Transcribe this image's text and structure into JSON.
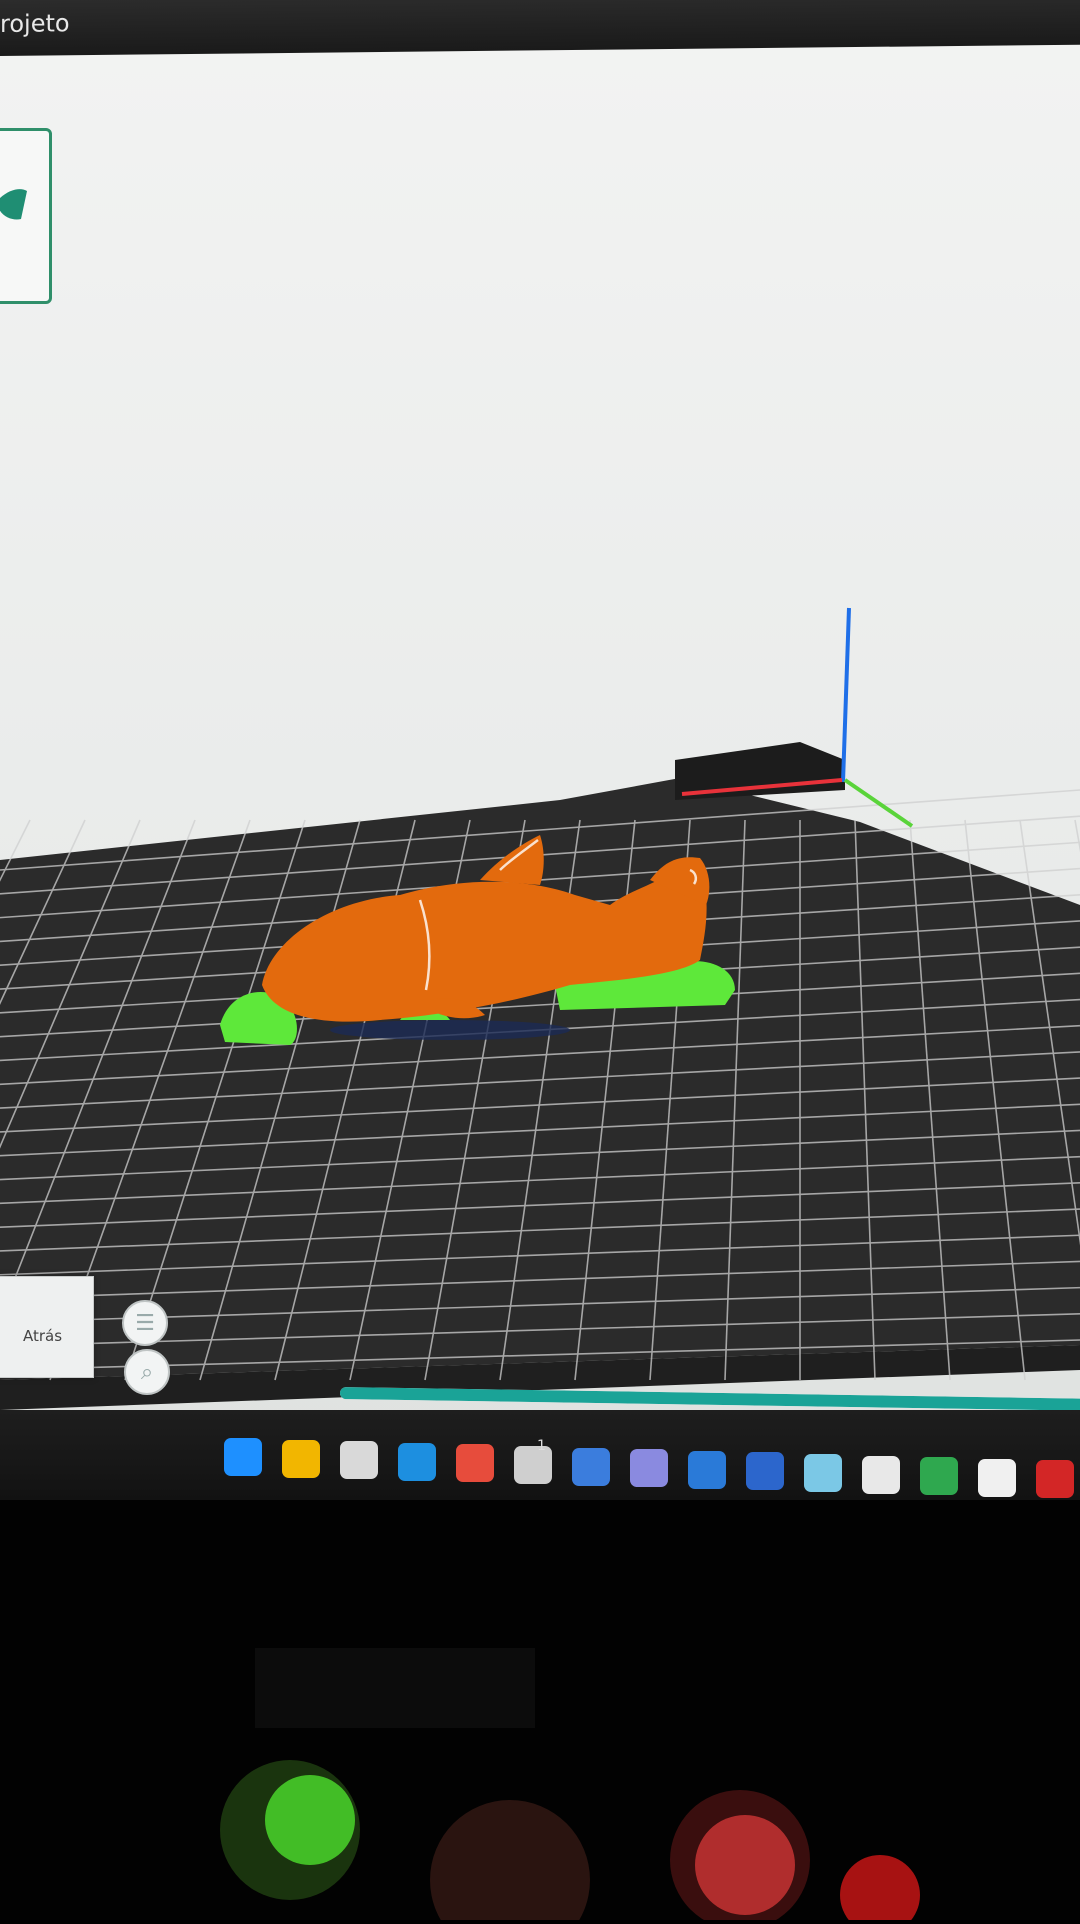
{
  "window": {
    "title": "rojeto"
  },
  "navigation": {
    "view_cube_label": "Atrás",
    "menu_icon": "menu-icon",
    "zoom_icon": "search-icon"
  },
  "slicing_progress": {
    "fraction": 0.99
  },
  "taskbar": {
    "icons": [
      {
        "name": "windows-start-icon",
        "color": "#1e90ff"
      },
      {
        "name": "file-explorer-icon",
        "color": "#f2b600"
      },
      {
        "name": "microsoft-store-icon",
        "color": "#d9d9d9"
      },
      {
        "name": "edge-icon",
        "color": "#1d8fe0"
      },
      {
        "name": "chrome-icon",
        "color": "#e74c3c"
      },
      {
        "name": "slicer-app-icon",
        "color": "#cfcfcf"
      },
      {
        "name": "calculator-icon",
        "color": "#3b7ddd"
      },
      {
        "name": "photo-app-icon",
        "color": "#8a8ae0"
      },
      {
        "name": "paint-icon",
        "color": "#2a7ad8"
      },
      {
        "name": "remote-icon",
        "color": "#2c66cc"
      },
      {
        "name": "map-app-icon",
        "color": "#7bc8e6"
      },
      {
        "name": "printer-icon",
        "color": "#e8e8e8"
      },
      {
        "name": "green-app-icon",
        "color": "#2fa84f"
      },
      {
        "name": "speed-app-icon",
        "color": "#f0f0f0"
      },
      {
        "name": "acrobat-icon",
        "color": "#d32626"
      }
    ],
    "chrome_badge": "1"
  },
  "colors": {
    "model": "#e36a0d",
    "support": "#5ee83a",
    "bed": "#2b2b2b",
    "accent": "#1aa397"
  }
}
